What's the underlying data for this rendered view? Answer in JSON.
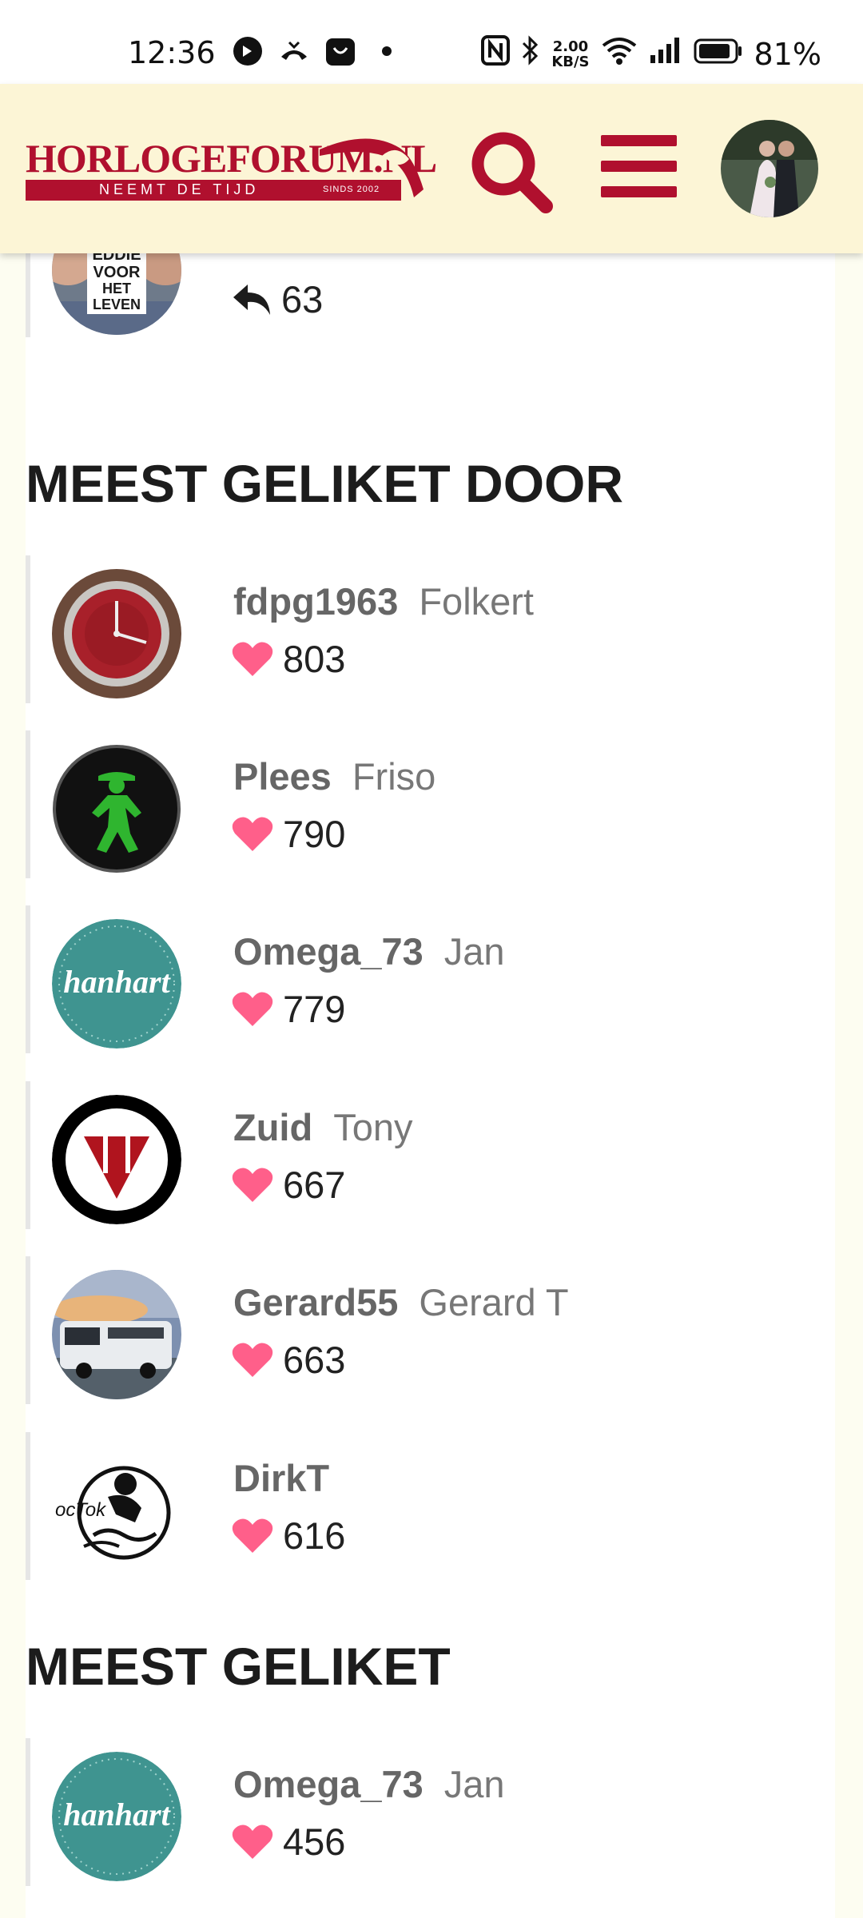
{
  "status_bar": {
    "time": "12:36",
    "net_speed_value": "2.00",
    "net_speed_unit": "KB/S",
    "battery": "81%"
  },
  "header": {
    "logo_text": "HORLOGEFORUM.NL",
    "logo_tagline": "NEEMT DE TIJD",
    "logo_since": "SINDS 2002",
    "brand_color": "#b0102e",
    "background": "#fcf5d6"
  },
  "top_row": {
    "avatar_text": [
      "EDDIE",
      "VOOR",
      "HET",
      "LEVEN"
    ],
    "replies": "63"
  },
  "sections": {
    "most_liked_by": {
      "title": "MEEST GELIKET DOOR",
      "rows": [
        {
          "username": "fdpg1963",
          "name": "Folkert",
          "likes": "803"
        },
        {
          "username": "Plees",
          "name": "Friso",
          "likes": "790"
        },
        {
          "username": "Omega_73",
          "name": "Jan",
          "likes": "779"
        },
        {
          "username": "Zuid",
          "name": "Tony",
          "likes": "667"
        },
        {
          "username": "Gerard55",
          "name": "Gerard T",
          "likes": "663"
        },
        {
          "username": "DirkT",
          "name": "",
          "likes": "616"
        }
      ]
    },
    "most_liked": {
      "title": "MEEST GELIKET",
      "rows": [
        {
          "username": "Omega_73",
          "name": "Jan",
          "likes": "456"
        }
      ]
    }
  },
  "avatar_labels": {
    "hanhart": "hanhart",
    "vostok": "ocTok"
  },
  "heart_color": "#ff5f8a"
}
